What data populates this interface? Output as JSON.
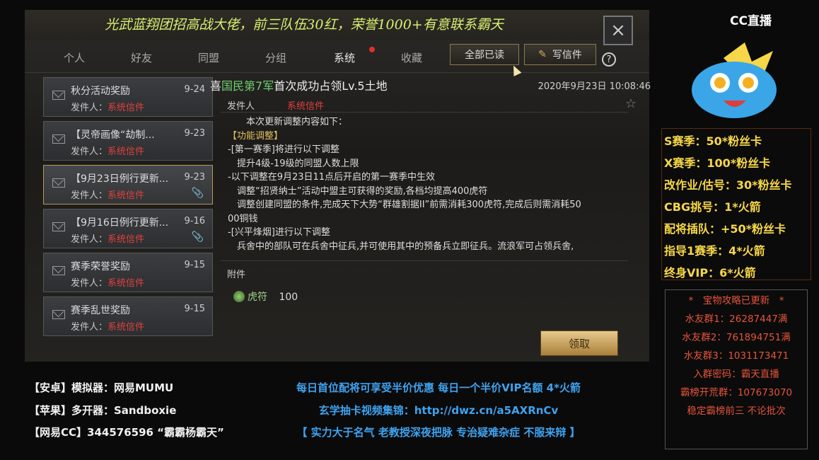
{
  "game": {
    "banner": "光武蓝翔团招高战大佬，前三队伍30红，荣誉1000+有意联系霸天",
    "tabs": [
      "个人",
      "好友",
      "同盟",
      "分组",
      "系统",
      "收藏"
    ],
    "read_all_label": "全部已读",
    "write_label": "写信件",
    "help_label": "?",
    "close_icon": "×"
  },
  "mail_list": [
    {
      "title": "秋分活动奖励",
      "date": "9-24",
      "sender_label": "发件人：",
      "sender": "系统信件",
      "attachment": false
    },
    {
      "title": "【灵帝画像“劫制...",
      "date": "9-23",
      "sender_label": "发件人：",
      "sender": "系统信件",
      "attachment": false
    },
    {
      "title": "【9月23日例行更新...",
      "date": "9-23",
      "sender_label": "发件人：",
      "sender": "系统信件",
      "attachment": true
    },
    {
      "title": "【9月16日例行更新...",
      "date": "9-16",
      "sender_label": "发件人：",
      "sender": "系统信件",
      "attachment": true
    },
    {
      "title": "赛季荣誉奖励",
      "date": "9-15",
      "sender_label": "发件人：",
      "sender": "系统信件",
      "attachment": false
    },
    {
      "title": "赛季乱世奖励",
      "date": "9-15",
      "sender_label": "发件人：",
      "sender": "系统信件",
      "attachment": false
    }
  ],
  "detail": {
    "title_pre": "喜",
    "title_green": "国民第7军",
    "title_post": "首次成功占领Lv.5土地",
    "date": "2020年9月23日 10:08:46",
    "sender_label": "发件人",
    "sender": "系统信件",
    "body": [
      "　　本次更新调整内容如下：",
      "【功能调整】",
      "-[第一赛季]将进行以下调整",
      "　提升4级-19级的同盟人数上限",
      "-以下调整在9月23日11点后开启的第一赛季中生效",
      "　调整“招贤纳士”活动中盟主可获得的奖励,各档均提高400虎符",
      "　调整创建同盟的条件,完成天下大势“群雄割据II”前需消耗300虎符,完成后则需消耗50",
      "00铜钱",
      "-[兴平烽烟]进行以下调整",
      "　兵舍中的部队可在兵舍中征兵,并可使用其中的预备兵立即征兵。流浪军可占领兵舍,"
    ],
    "attach_label": "附件",
    "item_name": "虎符",
    "item_qty": "100",
    "claim_label": "领取"
  },
  "overlay": {
    "logo": "CC直播",
    "promo": [
      "S赛季：50*粉丝卡",
      "X赛季：100*粉丝卡",
      "改作业/估号：30*粉丝卡",
      "CBG挑号：1*火箭",
      "配将插队：+50*粉丝卡",
      "指导1赛季：4*火箭",
      "终身VIP：6*火箭"
    ],
    "groups": [
      "*　宝物攻略已更新　*",
      "水友群1：26287447满",
      "水友群2：761894751满",
      "水友群3：1031173471",
      "入群密码：霸天直播",
      "霸榜开荒群：107673070",
      "稳定霸榜前三 不论批次"
    ],
    "bottom_left": [
      "【安卓】模拟器：网易MUMU",
      "【苹果】多开器：Sandboxie",
      "【网易CC】344576596 “霸霸杨霸天”"
    ],
    "bottom_mid": [
      "每日首位配将可享受半价优惠 每日一个半价VIP名额 4*火箭",
      "玄学抽卡视频集锦：http://dwz.cn/a5AXRnCv",
      "【 实力大于名气 老教授深夜把脉 专治疑难杂症 不服来辩 】"
    ]
  },
  "colors": {
    "accent_red": "#e04040",
    "promo_yellow": "#f7d748",
    "link_blue": "#3fa3f0",
    "green_name": "#6fd06f"
  }
}
